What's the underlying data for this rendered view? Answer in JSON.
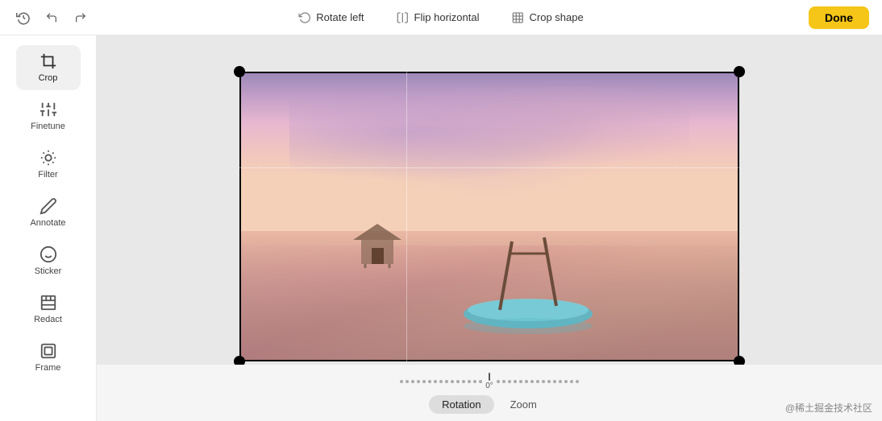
{
  "topbar": {
    "done_label": "Done",
    "undo_label": "Undo",
    "redo_label": "Redo",
    "history_label": "History",
    "actions": [
      {
        "id": "rotate-left",
        "label": "Rotate left"
      },
      {
        "id": "flip-horizontal",
        "label": "Flip horizontal"
      },
      {
        "id": "crop-shape",
        "label": "Crop shape"
      }
    ]
  },
  "sidebar": {
    "items": [
      {
        "id": "crop",
        "label": "Crop",
        "active": true
      },
      {
        "id": "finetune",
        "label": "Finetune",
        "active": false
      },
      {
        "id": "filter",
        "label": "Filter",
        "active": false
      },
      {
        "id": "annotate",
        "label": "Annotate",
        "active": false
      },
      {
        "id": "sticker",
        "label": "Sticker",
        "active": false
      },
      {
        "id": "redact",
        "label": "Redact",
        "active": false
      },
      {
        "id": "frame",
        "label": "Frame",
        "active": false
      }
    ]
  },
  "rotation": {
    "value": "0°",
    "tabs": [
      {
        "id": "rotation",
        "label": "Rotation",
        "active": true
      },
      {
        "id": "zoom",
        "label": "Zoom",
        "active": false
      }
    ]
  },
  "watermark": "@稀土掘金技术社区"
}
